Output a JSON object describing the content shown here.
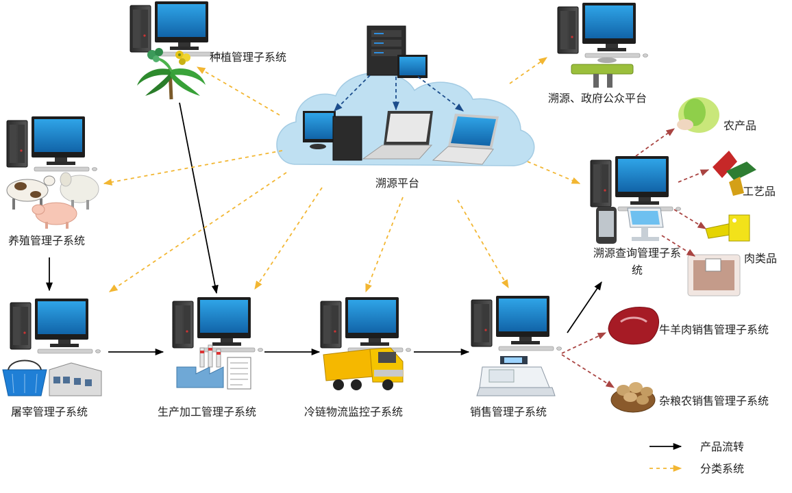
{
  "platform": {
    "label": "溯源平台"
  },
  "nodes": {
    "planting": "种植管理子系统",
    "breeding": "养殖管理子系统",
    "slaughter": "屠宰管理子系统",
    "processing": "生产加工管理子系统",
    "coldchain": "冷链物流监控子系统",
    "sales": "销售管理子系统",
    "gov": "溯源、政府公众平台",
    "query": "溯源查询管理子系统"
  },
  "products": {
    "agri": "农产品",
    "craft": "工艺品",
    "meat": "肉类品"
  },
  "retail": {
    "beef": "牛羊肉销售管理子系统",
    "grain": "杂粮农销售管理子系统"
  },
  "legend": {
    "flow": "产品流转",
    "classify": "分类系统"
  },
  "colors": {
    "flow_arrow": "#000000",
    "classify_arrow": "#f2b632",
    "product_arrow": "#a94442",
    "monitor_screen": "#1b86cf",
    "cloud": "#bfe0f2",
    "cloud_stroke": "#a3cbe3"
  }
}
